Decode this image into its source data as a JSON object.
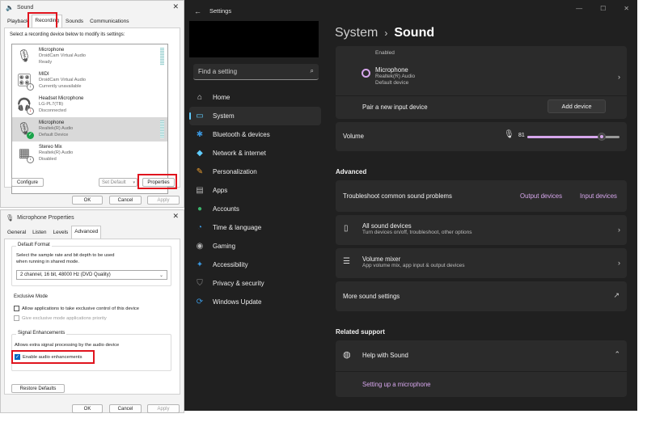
{
  "sound_dialog": {
    "title": "Sound",
    "tabs": [
      "Playback",
      "Recording",
      "Sounds",
      "Communications"
    ],
    "hint": "Select a recording device below to modify its settings:",
    "devices": [
      {
        "name": "Microphone",
        "driver": "DroidCam Virtual Audio",
        "status": "Ready",
        "icon": "microphone-icon"
      },
      {
        "name": "MIDI",
        "driver": "DroidCam Virtual Audio",
        "status": "Currently unavailable",
        "icon": "midi-device-icon"
      },
      {
        "name": "Headset Microphone",
        "driver": "LG-PL7(TB)",
        "status": "Disconnected",
        "icon": "headset-icon"
      },
      {
        "name": "Microphone",
        "driver": "Realtek(R) Audio",
        "status": "Default Device",
        "icon": "microphone-icon"
      },
      {
        "name": "Stereo Mix",
        "driver": "Realtek(R) Audio",
        "status": "Disabled",
        "icon": "stereo-mix-icon"
      }
    ],
    "configure": "Configure",
    "set_default": "Set Default",
    "properties": "Properties",
    "ok": "OK",
    "cancel": "Cancel",
    "apply": "Apply"
  },
  "mic_properties": {
    "title": "Microphone Properties",
    "tabs": [
      "General",
      "Listen",
      "Levels",
      "Advanced"
    ],
    "default_format": {
      "legend": "Default Format",
      "text": "Select the sample rate and bit depth to be used when running in shared mode.",
      "value": "2 channel, 16 bit, 48000 Hz (DVD Quality)"
    },
    "exclusive_mode": {
      "legend": "Exclusive Mode",
      "allow": "Allow applications to take exclusive control of this device",
      "priority": "Give exclusive mode applications priority"
    },
    "signal": {
      "legend": "Signal Enhancements",
      "text": "Allows extra signal processing by the audio device",
      "enable": "Enable audio enhancements"
    },
    "restore": "Restore Defaults",
    "ok": "OK",
    "cancel": "Cancel",
    "apply": "Apply"
  },
  "settings": {
    "title": "Settings",
    "search_placeholder": "Find a setting",
    "nav": [
      {
        "label": "Home",
        "icon": "home-icon",
        "color": "#d9d9d9"
      },
      {
        "label": "System",
        "icon": "system-icon",
        "color": "#60cdff"
      },
      {
        "label": "Bluetooth & devices",
        "icon": "bluetooth-icon",
        "color": "#3a96dd"
      },
      {
        "label": "Network & internet",
        "icon": "network-icon",
        "color": "#60cdff"
      },
      {
        "label": "Personalization",
        "icon": "brush-icon",
        "color": "#f0a030"
      },
      {
        "label": "Apps",
        "icon": "apps-icon",
        "color": "#b5b5b5"
      },
      {
        "label": "Accounts",
        "icon": "accounts-icon",
        "color": "#3bb36b"
      },
      {
        "label": "Time & language",
        "icon": "clock-icon",
        "color": "#3a96dd"
      },
      {
        "label": "Gaming",
        "icon": "gaming-icon",
        "color": "#b5b5b5"
      },
      {
        "label": "Accessibility",
        "icon": "accessibility-icon",
        "color": "#3a96dd"
      },
      {
        "label": "Privacy & security",
        "icon": "shield-icon",
        "color": "#8a8a8a"
      },
      {
        "label": "Windows Update",
        "icon": "update-icon",
        "color": "#3a96dd"
      }
    ],
    "breadcrumb_parent": "System",
    "breadcrumb_current": "Sound",
    "enabled_text": "Enabled",
    "input_device": {
      "name": "Microphone",
      "driver": "Realtek(R) Audio",
      "status": "Default device"
    },
    "pair_label": "Pair a new input device",
    "add_device": "Add device",
    "volume_label": "Volume",
    "volume_value": "81",
    "volume_level": 0.81,
    "advanced_heading": "Advanced",
    "troubleshoot_label": "Troubleshoot common sound problems",
    "output_devices": "Output devices",
    "input_devices": "Input devices",
    "all_sound_devices": {
      "title": "All sound devices",
      "sub": "Turn devices on/off, troubleshoot, other options"
    },
    "volume_mixer": {
      "title": "Volume mixer",
      "sub": "App volume mix, app input & output devices"
    },
    "more_sound_settings": "More sound settings",
    "related_heading": "Related support",
    "help_with_sound": "Help with Sound",
    "setting_up_mic": "Setting up a microphone",
    "accent": "#d6a6ec"
  }
}
